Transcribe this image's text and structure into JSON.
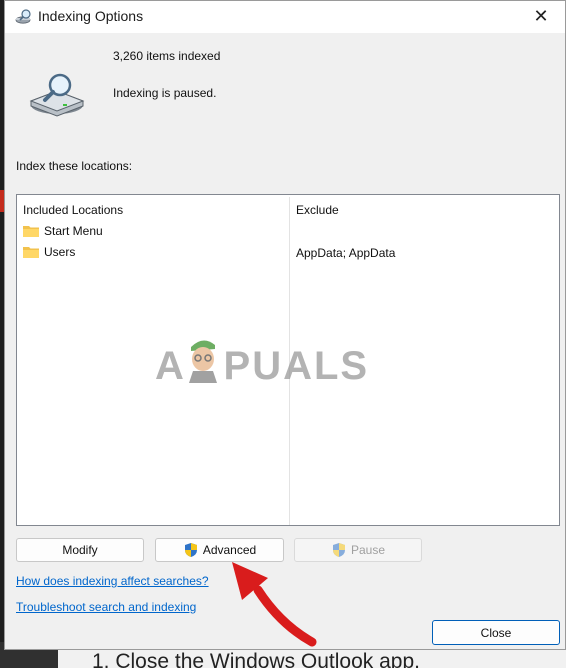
{
  "window": {
    "title": "Indexing Options",
    "close_glyph": "✕",
    "title_icon": "indexing-options-icon"
  },
  "summary": {
    "items_indexed": "3,260 items indexed",
    "status": "Indexing is paused.",
    "drive_icon": "drive-search-icon"
  },
  "locations": {
    "label": "Index these locations:",
    "headers": {
      "included": "Included Locations",
      "exclude": "Exclude"
    },
    "rows": [
      {
        "name": "Start Menu",
        "exclude": ""
      },
      {
        "name": "Users",
        "exclude": "AppData; AppData"
      }
    ]
  },
  "buttons": {
    "modify": "Modify",
    "advanced": "Advanced",
    "pause": "Pause",
    "close": "Close"
  },
  "links": {
    "how_indexing": "How does indexing affect searches?",
    "troubleshoot": "Troubleshoot search and indexing"
  },
  "watermark": "A PUALS",
  "background": {
    "partial_text": "1. Close the Windows Outlook app."
  },
  "colors": {
    "link": "#0066cc",
    "accent_border": "#005fb8",
    "annotation_arrow": "#d91c1c"
  }
}
